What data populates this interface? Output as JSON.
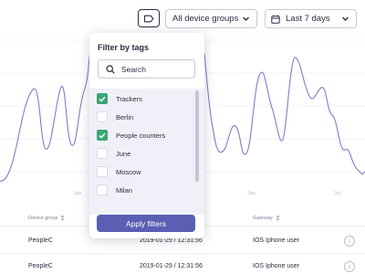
{
  "toolbar": {
    "tag_button_icon": "tag-icon",
    "device_groups": {
      "selected": "All device groups"
    },
    "date_range": {
      "selected": "Last 7 days"
    }
  },
  "chart": {
    "line_color": "#7b80c9",
    "x_ticks": [
      "Jun",
      "Jun",
      "Jul"
    ]
  },
  "table": {
    "headers": {
      "device_group": "Device group",
      "gateway": "Gateway"
    },
    "rows": [
      {
        "device_group": "PeopleC",
        "timestamp": "2019-01-29 / 12:31:56",
        "gateway": "IOS Iphone user"
      },
      {
        "device_group": "PeopleC",
        "timestamp": "2019-01-29 / 12:31:56",
        "gateway": "IOS Iphone user"
      }
    ],
    "info_icon": "info-icon"
  },
  "filter_popover": {
    "title": "Filter by tags",
    "search": {
      "placeholder": "Search",
      "value": ""
    },
    "tags": [
      {
        "label": "Trackers",
        "checked": true
      },
      {
        "label": "Berlin",
        "checked": false
      },
      {
        "label": "People counters",
        "checked": true
      },
      {
        "label": "June",
        "checked": false
      },
      {
        "label": "Moscow",
        "checked": false
      },
      {
        "label": "Milan",
        "checked": false
      }
    ],
    "apply_label": "Apply filters",
    "apply_color": "#5a5fb3",
    "check_color": "#3aa676"
  }
}
